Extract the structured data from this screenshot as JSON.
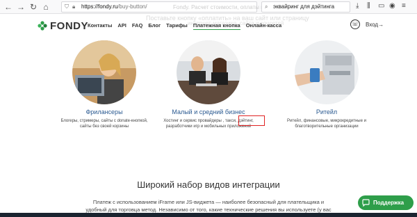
{
  "browser": {
    "url_host": "https://fondy.ru",
    "url_path": "/buy-button/",
    "search_value": "эквайринг для дэйтинга",
    "background_ghost_text": "Fondy. Расчет стоимости, оплаты по товару"
  },
  "header": {
    "logo_text": "FONDY",
    "faded_line1": "Поставьте кнопку «оплатить» на ваш сайт или страницу",
    "faded_line2": "интернет-магазина, сайта и соцсетей",
    "nav": [
      "Контакты",
      "API",
      "FAQ",
      "Блог",
      "Тарифы",
      "Платежная кнопка",
      "Онлайн-касса"
    ],
    "login_label": "Вход→"
  },
  "cards": [
    {
      "title": "Фрилансеры",
      "desc_line1": "Блогеры, стримеры, сайты с donate-кнопкой,",
      "desc_line2": "сайты без своей корзины"
    },
    {
      "title": "Малый и средний бизнес",
      "desc_line1": "Хостинг и сервис провайдеры , такси, дэйтинг,",
      "desc_line2": "разработчики игр и мобильных приложений"
    },
    {
      "title": "Ритейл",
      "desc_line1": "Ритейл, финансовые, микрокредитные и",
      "desc_line2": "благотворительные организации"
    }
  ],
  "integration": {
    "title": "Широкий набор видов интеграции",
    "text_line1": "Платеж с использованием iFrame или JS-виджета — наиболее безопасный для плательщика и",
    "text_line2": "удобный для торговца метод. Независимо от того, какие технические решения вы используете (у вас"
  },
  "support": {
    "label": "Поддержка"
  },
  "colors": {
    "brand_green": "#2e9e4a",
    "card_title_blue": "#2b5a91",
    "highlight_red": "#e02222"
  }
}
